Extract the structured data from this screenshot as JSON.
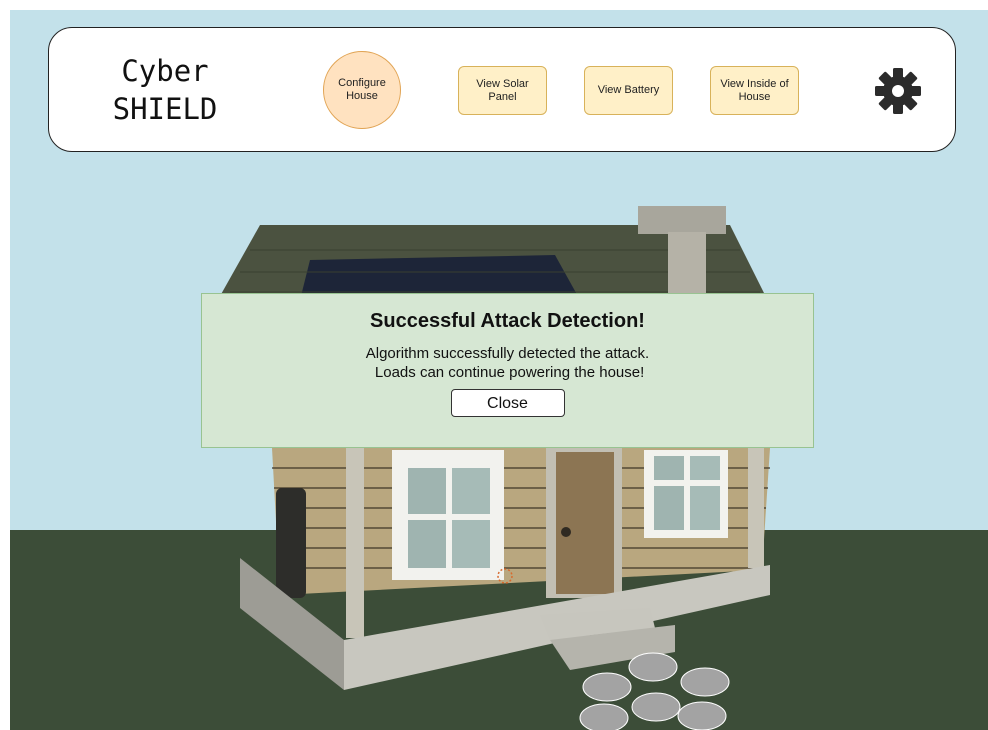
{
  "app": {
    "logo_line1": "Cyber",
    "logo_line2": "SHIELD"
  },
  "nav": {
    "configure": "Configure\nHouse",
    "solar": "View Solar\nPanel",
    "battery": "View Battery",
    "inside": "View Inside of\nHouse",
    "settings_icon": "gear-icon"
  },
  "dialog": {
    "title": "Successful Attack Detection!",
    "line1": "Algorithm successfully detected the attack.",
    "line2": " Loads can continue powering the house!",
    "close_label": "Close"
  },
  "colors": {
    "sky": "#c3e1ea",
    "ground": "#3c4d38",
    "dialog_bg": "#d6e7d3",
    "nav_button_bg": "#fff0c8",
    "nav_button_border": "#d8b25a"
  }
}
